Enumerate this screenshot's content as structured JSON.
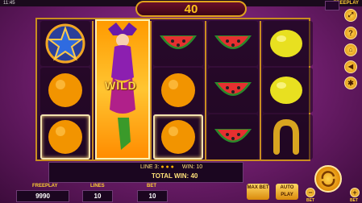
{
  "status_bar": {
    "time": "11:45",
    "mode_badge": "FREEPLAY"
  },
  "win_banner": {
    "value": "40"
  },
  "reels": {
    "columns": [
      [
        "star-icon",
        "orange-icon",
        "orange-icon"
      ],
      [
        "wild-jester-icon"
      ],
      [
        "watermelon-icon",
        "orange-icon",
        "orange-icon"
      ],
      [
        "watermelon-icon",
        "watermelon-icon",
        "watermelon-icon"
      ],
      [
        "lemon-icon",
        "lemon-icon",
        "horseshoe-icon"
      ]
    ],
    "wild_label": "WILD"
  },
  "win_info": {
    "line_label": "LINE 3:",
    "win_label": "WIN: 10",
    "total_label": "TOTAL WIN: 40"
  },
  "stats": {
    "freeplay_label": "FREEPLAY",
    "freeplay_value": "9990",
    "lines_label": "LINES",
    "lines_value": "10",
    "bet_label": "BET",
    "bet_value": "10"
  },
  "buttons": {
    "max_bet": "MAX BET",
    "auto_play": "AUTO PLAY",
    "bet_minus": "BET",
    "bet_plus": "BET"
  },
  "colors": {
    "accent": "#ffc21a",
    "background": "#6a1c68",
    "frame": "#c98d20"
  }
}
